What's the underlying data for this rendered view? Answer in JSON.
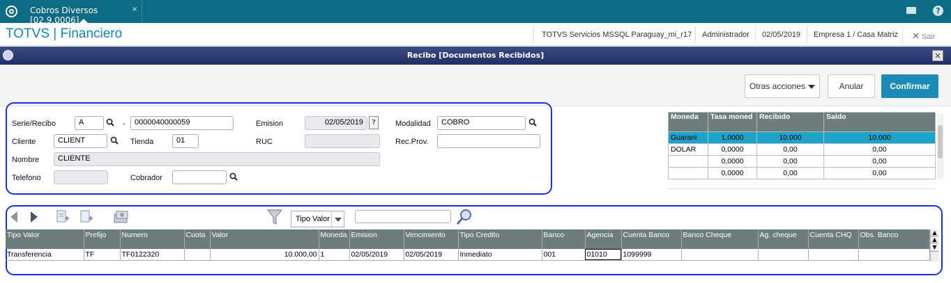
{
  "app": {
    "tab_title": "Cobros Diversos [02.9.0006]",
    "tab_close": "×",
    "brand": "TOTVS | Financiero"
  },
  "header": {
    "env": "TOTVS Servicios MSSQL Paraguay_mi_r17",
    "user": "Administrador",
    "date": "02/05/2019",
    "company": "Empresa 1 / Casa Matriz",
    "exit": "Sair"
  },
  "window": {
    "title": "Recibo [Documentos Recibidos]",
    "close": "×"
  },
  "toolbar": {
    "otras": "Otras acciones",
    "anular": "Anular",
    "confirmar": "Confirmar"
  },
  "form": {
    "serie_label": "Serie/Recibo",
    "serie": "A",
    "dash": "-",
    "recibo": "0000040000059",
    "emision_label": "Emision",
    "emision": "02/05/2019",
    "help": "?",
    "modalidad_label": "Modalidad",
    "modalidad": "COBRO",
    "cliente_label": "Cliente",
    "cliente": "CLIENT",
    "tienda_label": "Tienda",
    "tienda": "01",
    "ruc_label": "RUC",
    "ruc": "",
    "recprov_label": "Rec.Prov.",
    "recprov": "",
    "nombre_label": "Nombre",
    "nombre": "CLIENTE",
    "telefono_label": "Telefono",
    "telefono": "",
    "cobrador_label": "Cobrador",
    "cobrador": ""
  },
  "currency": {
    "headers": [
      "Moneda",
      "Tasa moned",
      "Recibido",
      "Saldo"
    ],
    "rows": [
      [
        "Guarani",
        "1,0000",
        "10.000",
        "10.000"
      ],
      [
        "DOLAR",
        "0,0000",
        "0,00",
        "0,00"
      ],
      [
        "",
        "0,0000",
        "0,00",
        "0,00"
      ],
      [
        "",
        "0,0000",
        "0,00",
        "0,00"
      ]
    ]
  },
  "filter": {
    "select": "Tipo Valor",
    "search": ""
  },
  "items": {
    "headers": [
      "Tipo Valor",
      "Prefijo",
      "Numero",
      "Cuota",
      "Valor",
      "Moneda",
      "Emision",
      "Vencimiento",
      "Tipo Credito",
      "Banco",
      "Agencia",
      "Cuenta Banco",
      "Banco Cheque",
      "Ag. cheque",
      "Cuenta CHQ",
      "Obs. Banco"
    ],
    "rows": [
      [
        "Transferencia",
        "TF",
        "TF0122320",
        "",
        "10.000,00",
        "1",
        "02/05/2019",
        "02/05/2019",
        "Inmediato",
        "001",
        "01010",
        "1099999",
        "",
        "",
        "",
        ""
      ]
    ]
  },
  "colors": {
    "topbar": "#0e6b84",
    "brand": "#1189ad",
    "primary": "#1c8bb7",
    "frame": "#1a2fdc",
    "grid_head": "#6d7c7c",
    "selected_row": "#1ea3c8"
  }
}
